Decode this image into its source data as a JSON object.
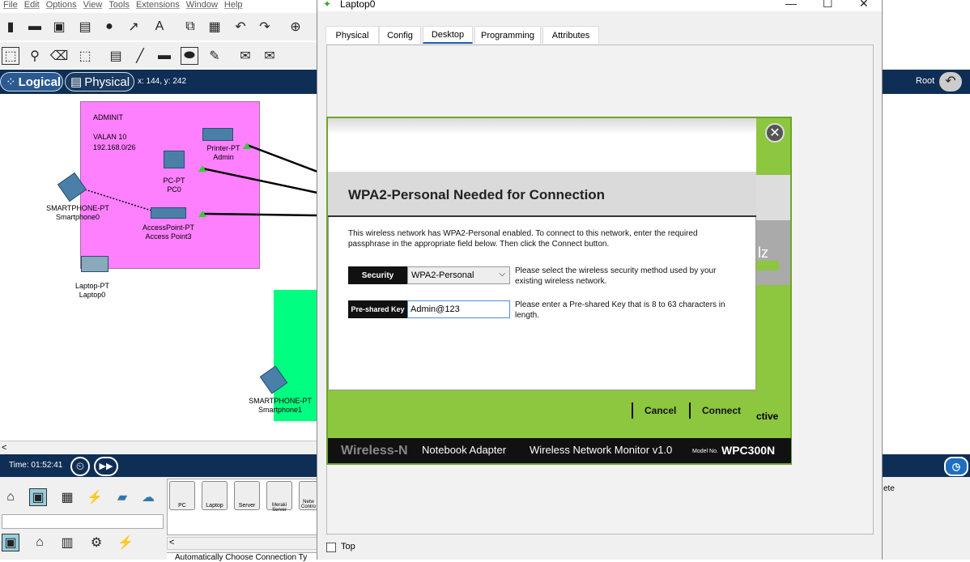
{
  "menu": [
    "File",
    "Edit",
    "Options",
    "View",
    "Tools",
    "Extensions",
    "Window",
    "Help"
  ],
  "mode": {
    "logical": "Logical",
    "physical": "Physical",
    "coords": "x: 144, y: 242",
    "root": "Root"
  },
  "canvas": {
    "zone_title": "ADMINIT",
    "zone_vlan": "VALAN 10",
    "zone_subnet": "192.168.0/26",
    "printer": "Printer-PT\nAdmin",
    "pc": "PC-PT\nPC0",
    "ap": "AccessPoint-PT\nAccess Point3",
    "phone0": "SMARTPHONE-PT\nSmartphone0",
    "laptop0": "Laptop-PT\nLaptop0",
    "phone1": "SMARTPHONE-PT\nSmartphone1"
  },
  "time": "Time: 01:52:41",
  "devicebar": [
    "PC",
    "Laptop",
    "Server",
    "Meraki Server",
    "Netw Contro"
  ],
  "status_text": "Automatically Choose Connection Ty",
  "right_partial": "ete",
  "window": {
    "title": "Laptop0",
    "tabs": [
      "Physical",
      "Config",
      "Desktop",
      "Programming",
      "Attributes"
    ],
    "top_label": "Top"
  },
  "dialog": {
    "heading": "WPA2-Personal Needed for Connection",
    "description": "This wireless network has WPA2-Personal enabled. To connect to this network, enter the required passphrase in the appropriate field below. Then click the Connect button.",
    "security_label": "Security",
    "security_value": "WPA2-Personal",
    "security_help": "Please select the wireless security method used by your existing wireless network.",
    "psk_label": "Pre-shared Key",
    "psk_value": "Admin@123",
    "psk_help": "Please enter a Pre-shared Key that is 8 to 63 characters in length.",
    "cancel": "Cancel",
    "connect": "Connect",
    "side_partial": "ctive",
    "side_partial2": "lz",
    "footer_brand": "Wireless-N",
    "footer_product": "Notebook Adapter",
    "footer_monitor": "Wireless Network Monitor  v1.0",
    "footer_model_label": "Model No.",
    "footer_model": "WPC300N"
  }
}
